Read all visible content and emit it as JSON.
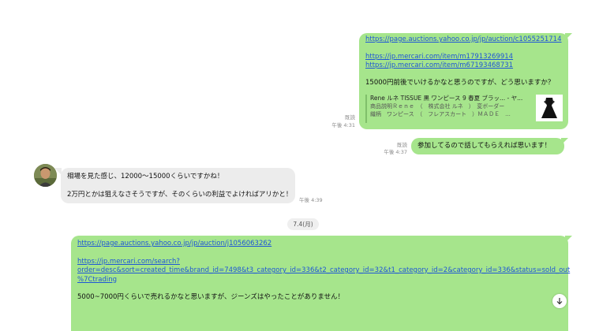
{
  "messages": [
    {
      "id": "m1",
      "side": "right",
      "links": [
        "https://page.auctions.yahoo.co.jp/jp/auction/c1055251714",
        "https://jp.mercari.com/item/m17913269914",
        "https://jp.mercari.com/item/m67193468731"
      ],
      "text": "15000円前後でいけるかなと思うのですが、どう思いますか？",
      "preview": {
        "title": "Rene ルネ TISSUE 黒 ワンピース 9 春夏 ブラッ... - ヤ...",
        "desc_line1": "商品説明Ｒｅｎｅ　（　株式会社 ルネ　）　変ボーダー",
        "desc_line2": "織柄　ワンピース　（　フレアスカート　）ＭＡＤＥ　..."
      },
      "read": "既読",
      "time": "午後 4:31"
    },
    {
      "id": "m2",
      "side": "right",
      "text": "参加してるので話してもらえれば思います！",
      "read": "既読",
      "time": "午後 4:37"
    },
    {
      "id": "m3",
      "side": "left",
      "line1": "相場を見た感じ、12000〜15000くらいですかね！",
      "line2": "2万円とかは狙えなさそうですが、そのくらいの利益でよければアリかと！",
      "time": "午後 4:39"
    },
    {
      "id": "m4",
      "side": "right",
      "link1": "https://page.auctions.yahoo.co.jp/jp/auction/j1056063262",
      "link2_line1": "https://jp.mercari.com/search?",
      "link2_line2": "order=desc&sort=created_time&brand_id=7498&t3_category_id=336&t2_category_id=32&t1_category_id=2&category_id=336&status=sold_out",
      "link2_line3": "%7Ctrading",
      "text": "5000~7000円くらいで売れるかなと思いますが、ジーンズはやったことがありません！"
    }
  ],
  "date_separator": "7.4(月)",
  "icons": {
    "scroll_down": "arrow-down-icon"
  },
  "colors": {
    "green_bubble": "#a6e58c",
    "gray_bubble": "#ececec",
    "link": "#1e56d6"
  }
}
